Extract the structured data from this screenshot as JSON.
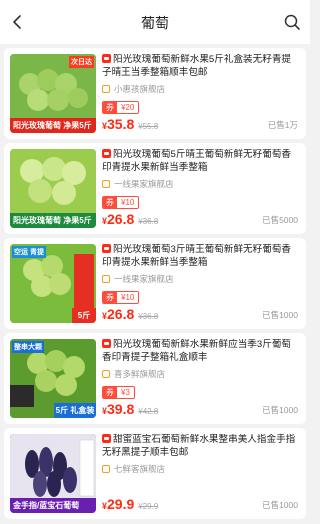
{
  "header": {
    "title": "葡萄"
  },
  "products": [
    {
      "title": "阳光玫瑰葡萄新鲜水果5斤礼盒装无籽青提子晴王当季整箱顺丰包邮",
      "shop": "小惠孩旗舰店",
      "coupon_label": "券",
      "coupon_value": "¥20",
      "price_symbol": "¥",
      "price": "35.8",
      "original_price": "¥55.8",
      "sold": "已售1万",
      "image_badge": "次日达",
      "image_caption": "阳光玫瑰葡萄 净果5斤",
      "image_colors": [
        "#6fae3a",
        "#a9d46b"
      ]
    },
    {
      "title": "阳光玫瑰葡萄5斤晴王葡萄新鲜无籽葡萄香印青提水果新鲜当季整箱",
      "shop": "一线果家旗舰店",
      "coupon_label": "券",
      "coupon_value": "¥10",
      "price_symbol": "¥",
      "price": "26.8",
      "original_price": "¥36.8",
      "sold": "已售5000",
      "image_badge": "",
      "image_caption": "阳光玫瑰葡萄 净果5斤",
      "image_colors": [
        "#9ccc4e",
        "#d7ec9d"
      ]
    },
    {
      "title": "阳光玫瑰葡萄3斤晴王葡萄新鲜无籽葡萄香印青提水果新鲜当季整箱",
      "shop": "一线果家旗舰店",
      "coupon_label": "券",
      "coupon_value": "¥10",
      "price_symbol": "¥",
      "price": "26.8",
      "original_price": "¥36.8",
      "sold": "已售1000",
      "image_badge": "空运 青提",
      "image_caption": "5斤",
      "image_colors": [
        "#7cbc3c",
        "#c6e27f"
      ]
    },
    {
      "title": "阳光玫瑰葡萄新鲜水果新鲜应当季3斤葡萄香印青提子整箱礼盒顺丰",
      "shop": "喜多鲜旗舰店",
      "coupon_label": "券",
      "coupon_value": "¥3",
      "price_symbol": "¥",
      "price": "39.8",
      "original_price": "¥42.8",
      "sold": "已售1000",
      "image_badge": "整串大颗",
      "image_caption": "5斤 礼盒装",
      "image_colors": [
        "#5c9c2e",
        "#b4d86a"
      ]
    },
    {
      "title": "甜蜜蓝宝石葡萄新鲜水果整串美人指金手指无籽黑提子顺丰包邮",
      "shop": "七鲜客旗舰店",
      "coupon_label": "",
      "coupon_value": "",
      "price_symbol": "¥",
      "price": "29.9",
      "original_price": "¥29.9",
      "sold": "已售1000",
      "image_badge": "",
      "image_caption": "金手指/蓝宝石葡萄",
      "image_colors": [
        "#1f1c3a",
        "#4b4378"
      ]
    }
  ]
}
